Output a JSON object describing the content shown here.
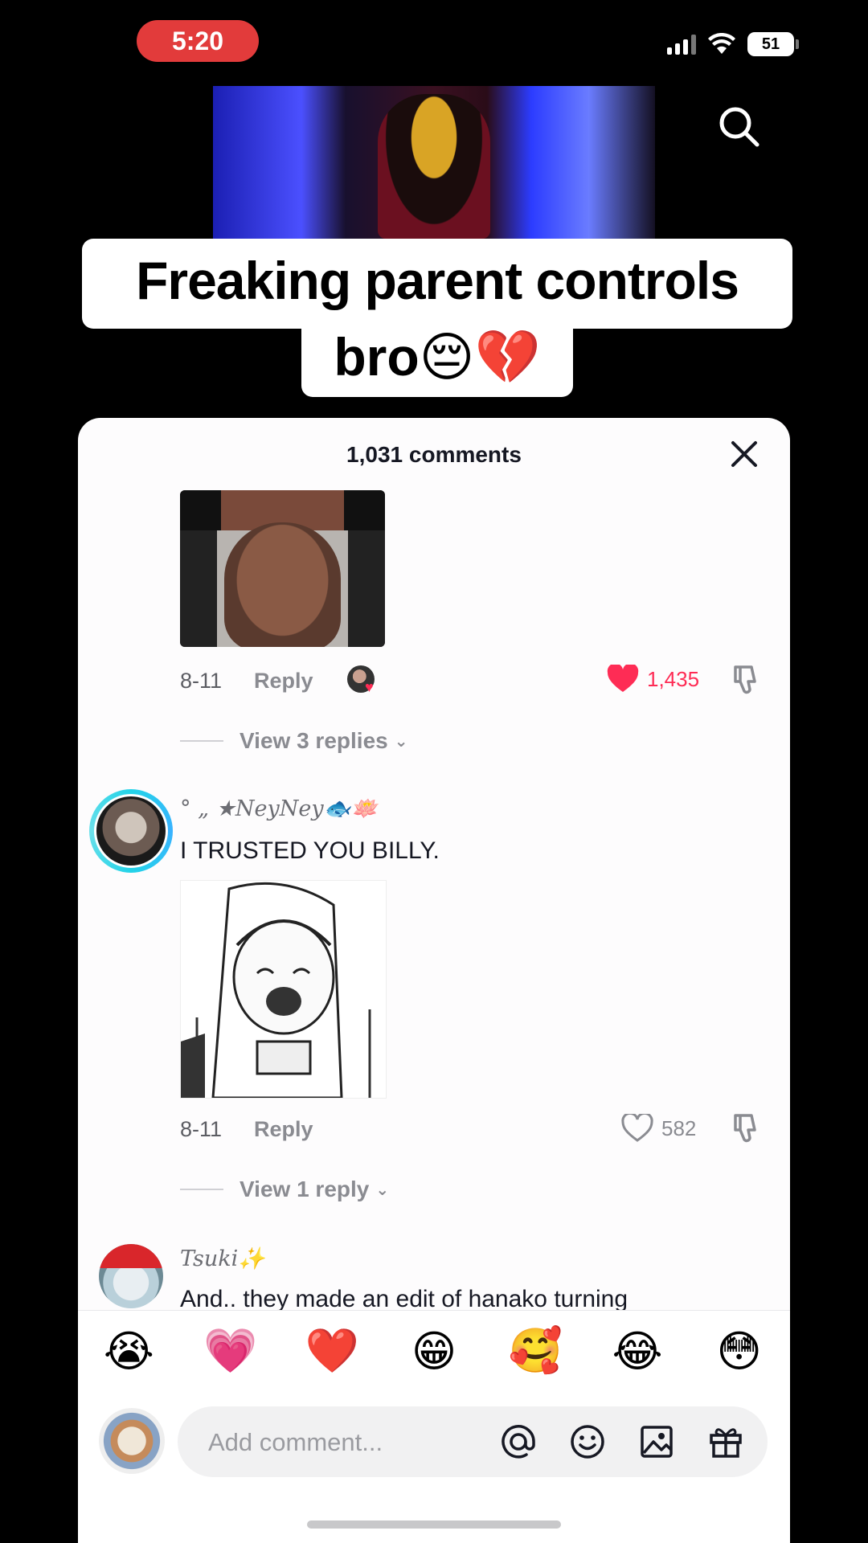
{
  "status_bar": {
    "time": "5:20",
    "battery": "51"
  },
  "caption": {
    "line1": "Freaking parent controls",
    "line2": "bro😔💔"
  },
  "comments_panel": {
    "title": "1,031 comments",
    "comments": [
      {
        "date": "8-11",
        "reply_label": "Reply",
        "likes": "1,435",
        "liked": true,
        "creator_liked": true,
        "view_replies": "View 3 replies"
      },
      {
        "username": "° „ ★NeyNey🐟🪷",
        "text": "I TRUSTED YOU BILLY.",
        "date": "8-11",
        "reply_label": "Reply",
        "likes": "582",
        "liked": false,
        "view_replies": "View 1 reply"
      },
      {
        "username": "Tsuki✨",
        "text": "And.. they made an edit of hanako turning"
      }
    ]
  },
  "emoji_bar": [
    "😭",
    "💗",
    "❤️",
    "😁",
    "🥰",
    "😂",
    "😳"
  ],
  "composer": {
    "placeholder": "Add comment..."
  },
  "colors": {
    "accent_like": "#fe2c55",
    "sheet_bg": "#fdfcfd",
    "text_primary": "#161823",
    "text_secondary": "#8a8b91"
  }
}
